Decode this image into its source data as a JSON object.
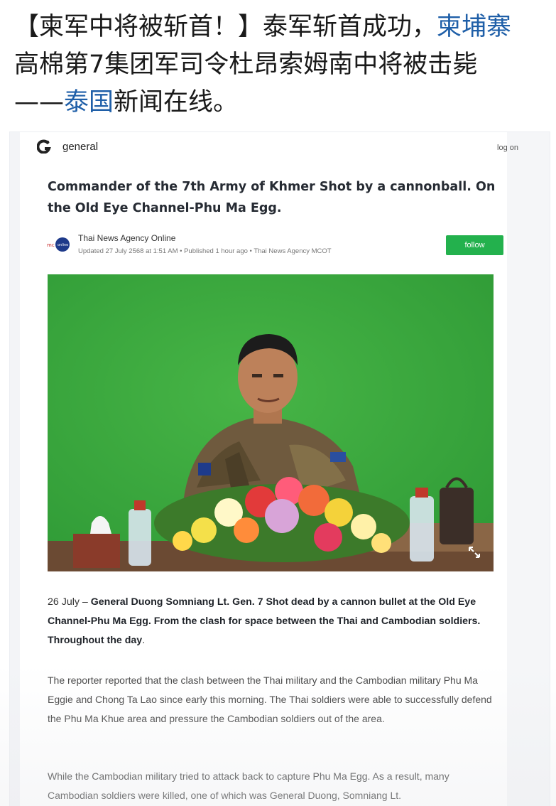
{
  "headline": {
    "part1": "【柬军中将被斩首！】泰军斩首成功，",
    "link1": "柬埔寨",
    "part2": "高棉第7集团军司令杜昂索姆南中将被击毙",
    "part3": "——",
    "link2": "泰国",
    "part4": "新闻在线。",
    "link_color": "#1f5fa8"
  },
  "site": {
    "name": "general",
    "login": "log on",
    "logo_icon": "g-logo-icon"
  },
  "article": {
    "title": "Commander of the 7th Army of Khmer Shot by a cannonball. On the Old Eye Channel-Phu Ma Egg.",
    "agency": "Thai News Agency Online",
    "meta": "Updated 27 July 2568 at 1:51 AM • Published 1 hour ago • Thai News Agency MCOT",
    "follow_label": "follow",
    "follow_color": "#23b14d",
    "photo_expand_icon": "expand-icon",
    "p1_lead": "26 July – ",
    "p1_bold": "General Duong Somniang Lt. Gen. 7 Shot dead by a cannon bullet at the Old Eye Channel-Phu Ma Egg. From the clash for space between the Thai and Cambodian soldiers. Throughout the day",
    "p1_end": ".",
    "p2": "The reporter reported that the clash between the Thai military and the Cambodian military Phu Ma Eggie and Chong Ta Lao since early this morning. The Thai soldiers were able to successfully defend the Phu Ma Khue area and pressure the Cambodian soldiers out of the area.",
    "p3": "While the Cambodian military tried to attack back to capture Phu Ma Egg. As a result, many Cambodian soldiers were killed, one of which was General Duong, Somniang Lt."
  }
}
